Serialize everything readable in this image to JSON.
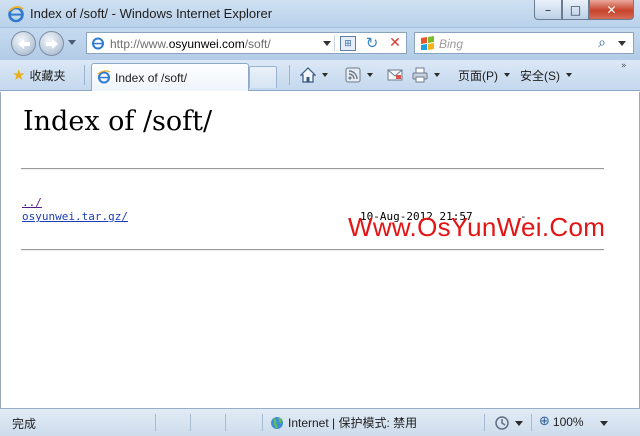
{
  "window": {
    "title": "Index of /soft/ - Windows Internet Explorer",
    "minimize_glyph": "–",
    "maximize_glyph": "□",
    "close_glyph": "✕"
  },
  "nav": {
    "address_prefix": "http://www.",
    "address_host": "osyunwei.com",
    "address_path": "/soft/",
    "search_placeholder": "Bing",
    "compat_glyph": "⊞",
    "refresh_glyph": "↻",
    "stop_glyph": "✕",
    "search_glyph": "⌕"
  },
  "command_bar": {
    "favorites_label": "收藏夹",
    "tab_label": "Index of /soft/",
    "page_label": "页面(P)",
    "safety_label": "安全(S)",
    "overflow_glyph": "»"
  },
  "page": {
    "heading": "Index of /soft/",
    "entries": [
      {
        "name": "../",
        "date": "",
        "size": ""
      },
      {
        "name": "osyunwei.tar.gz/",
        "date": "10-Aug-2012 21:57",
        "size": "-"
      }
    ],
    "watermark": "Www.OsYunWei.Com"
  },
  "status": {
    "text": "完成",
    "zone": "Internet | 保护模式: 禁用",
    "zoom": "100%"
  },
  "colors": {
    "accent": "#3d84c7",
    "watermark": "#e31414",
    "visited_link": "#551a8b",
    "link": "#1a3db8"
  }
}
